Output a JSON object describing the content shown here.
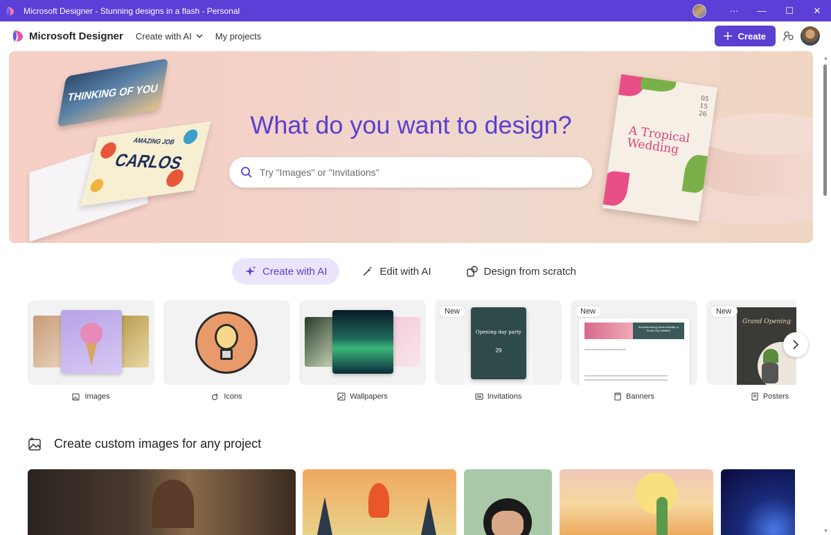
{
  "window": {
    "title": "Microsoft Designer - Stunning designs in a flash - Personal",
    "more_label": "···",
    "minimize_label": "—",
    "maximize_label": "☐",
    "close_label": "✕"
  },
  "header": {
    "brand": "Microsoft Designer",
    "nav": [
      {
        "label": "Create with AI"
      },
      {
        "label": "My projects"
      }
    ],
    "create_label": "Create",
    "accent_color": "#5a3fd0"
  },
  "hero": {
    "title": "What do you want to design?",
    "search_placeholder": "Try \"Images\" or \"Invitations\"",
    "card1_text": "THINKING OF YOU",
    "card2_small": "AMAZING JOB",
    "card2_big": "CARLOS",
    "invite_title": "A Tropical Wedding",
    "invite_date": "05\n15\n26"
  },
  "tabs": [
    {
      "label": "Create with AI",
      "icon": "sparkle-icon",
      "active": true
    },
    {
      "label": "Edit with AI",
      "icon": "wand-icon",
      "active": false
    },
    {
      "label": "Design from scratch",
      "icon": "shapes-icon",
      "active": false
    }
  ],
  "categories": [
    {
      "label": "Images",
      "icon": "image-sparkle-icon",
      "badge": ""
    },
    {
      "label": "Icons",
      "icon": "icon-shape-icon",
      "badge": ""
    },
    {
      "label": "Wallpapers",
      "icon": "wallpaper-icon",
      "badge": ""
    },
    {
      "label": "Invitations",
      "icon": "invitation-icon",
      "badge": "New",
      "preview_title": "Opening day party",
      "preview_date": "29"
    },
    {
      "label": "Banners",
      "icon": "banner-icon",
      "badge": "New",
      "preview_title": "Revolutionizing Urban Mobility: A Smart City Initiative"
    },
    {
      "label": "Posters",
      "icon": "poster-icon",
      "badge": "New",
      "preview_title": "Grand Opening"
    }
  ],
  "section": {
    "title": "Create custom images for any project",
    "icon": "image-sparkle-icon"
  }
}
